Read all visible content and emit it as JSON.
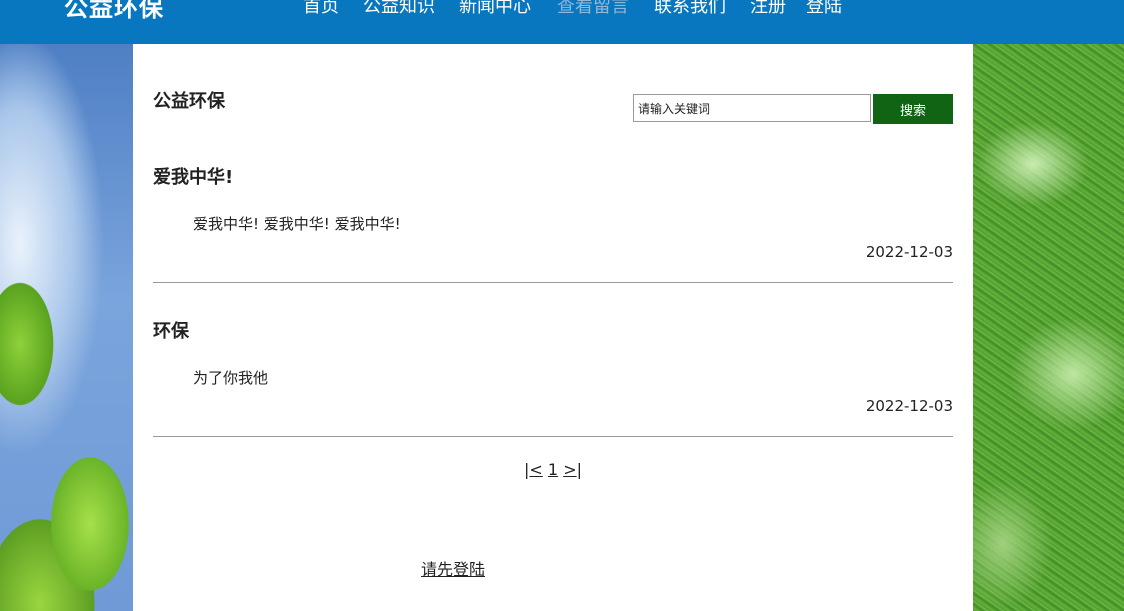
{
  "header": {
    "site_title": "公益环保",
    "nav": [
      {
        "label": "首页"
      },
      {
        "label": "公益知识"
      },
      {
        "label": "新闻中心"
      },
      {
        "label": "查看留言"
      },
      {
        "label": "联系我们"
      },
      {
        "label": "注册"
      },
      {
        "label": "登陆"
      }
    ],
    "active_nav": "查看留言",
    "brand_color": "#0877bf"
  },
  "main": {
    "section_title": "公益环保",
    "search": {
      "value": "请输入关键词",
      "button_label": "搜索",
      "button_color": "#116413"
    },
    "posts": [
      {
        "title": "爱我中华!",
        "body": "爱我中华!  爱我中华!  爱我中华!",
        "date": "2022-12-03"
      },
      {
        "title": "环保",
        "body": "为了你我他",
        "date": "2022-12-03"
      }
    ],
    "pagination": {
      "open": "|",
      "prev": "<",
      "page": "1",
      "next": ">",
      "close": "|"
    },
    "login_prompt": "请先登陆"
  }
}
